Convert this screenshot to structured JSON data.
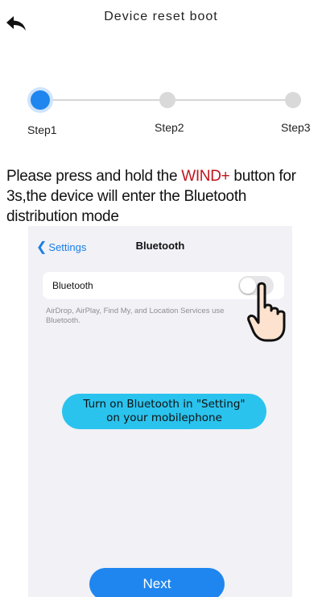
{
  "header": {
    "title": "Device reset boot",
    "back_icon": "back-arrow-icon"
  },
  "steps": {
    "current": 1,
    "items": [
      {
        "label": "Step1",
        "active": true
      },
      {
        "label": "Step2",
        "active": false
      },
      {
        "label": "Step3",
        "active": false
      }
    ]
  },
  "instruction": {
    "prefix": "Please press and hold the ",
    "highlight": "WIND+",
    "suffix": " button for 3s,the device will enter the Bluetooth distribution mode"
  },
  "illustration": {
    "back_label": "Settings",
    "screen_title": "Bluetooth",
    "row_label": "Bluetooth",
    "toggle_on": false,
    "description": "AirDrop, AirPlay, Find My, and Location Services use Bluetooth.",
    "callout_line1": "Turn on Bluetooth in \"Setting\"",
    "callout_line2": "on your mobilephone"
  },
  "next_button": {
    "label": "Next"
  },
  "colors": {
    "accent": "#1f86ef",
    "highlight": "#c0141b",
    "callout": "#2ac3ee",
    "ios_link": "#1a7fe6"
  }
}
